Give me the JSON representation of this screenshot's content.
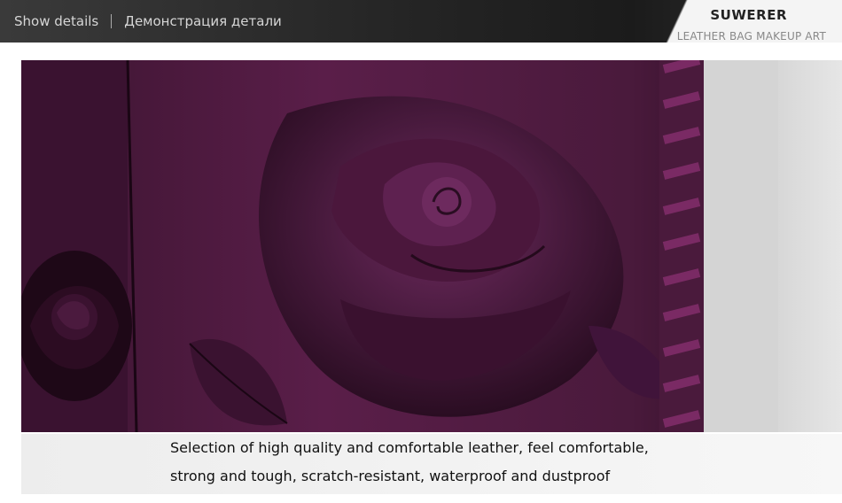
{
  "header": {
    "show_details": "Show details",
    "separator": "|",
    "show_details_ru": "Демонстрация детали"
  },
  "brand": {
    "name": "SUWERER",
    "tagline": "LEATHER BAG MAKEUP ART"
  },
  "image": {
    "subject": "closeup of purple embossed rose leather bag",
    "main_color": "#4a1a3c",
    "accent_color": "#7a2a64"
  },
  "caption": {
    "line1": "Selection of high quality and comfortable leather, feel comfortable,",
    "line2": "strong and tough, scratch-resistant, waterproof and dustproof"
  }
}
